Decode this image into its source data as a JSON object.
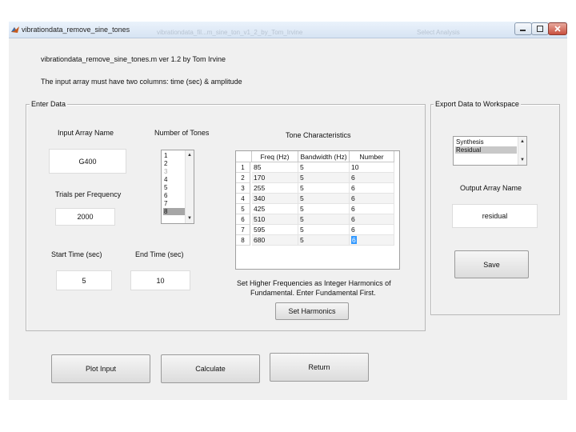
{
  "window": {
    "title": "vibrationdata_remove_sine_tones",
    "ghost_text_1": "vibrationdata_fil...m_sine_ton_v1_2_by_Tom_Irvine",
    "ghost_text_2": "Select Analysis"
  },
  "header": {
    "line1": "vibrationdata_remove_sine_tones.m ver 1.2 by Tom Irvine",
    "line2": "The input array must have two columns: time (sec) & amplitude"
  },
  "enter_data": {
    "title": "Enter Data",
    "input_array_label": "Input Array Name",
    "input_array_value": "G400",
    "trials_label": "Trials per Frequency",
    "trials_value": "2000",
    "start_time_label": "Start Time (sec)",
    "start_time_value": "5",
    "end_time_label": "End Time (sec)",
    "end_time_value": "10",
    "num_tones_label": "Number of Tones",
    "num_tones_options": [
      "1",
      "2",
      "3",
      "4",
      "5",
      "6",
      "7",
      "8"
    ],
    "num_tones_selected": "8",
    "tone_title": "Tone Characteristics",
    "tone_columns": [
      "Freq (Hz)",
      "Bandwidth (Hz)",
      "Number"
    ],
    "tone_rows": [
      {
        "n": "1",
        "freq": "85",
        "bw": "5",
        "num": "10"
      },
      {
        "n": "2",
        "freq": "170",
        "bw": "5",
        "num": "6"
      },
      {
        "n": "3",
        "freq": "255",
        "bw": "5",
        "num": "6"
      },
      {
        "n": "4",
        "freq": "340",
        "bw": "5",
        "num": "6"
      },
      {
        "n": "5",
        "freq": "425",
        "bw": "5",
        "num": "6"
      },
      {
        "n": "6",
        "freq": "510",
        "bw": "5",
        "num": "6"
      },
      {
        "n": "7",
        "freq": "595",
        "bw": "5",
        "num": "6"
      },
      {
        "n": "8",
        "freq": "680",
        "bw": "5",
        "num": "6"
      }
    ],
    "harmonics_note_1": "Set Higher Frequencies as Integer Harmonics of",
    "harmonics_note_2": "Fundamental. Enter Fundamental First.",
    "set_harmonics_label": "Set Harmonics"
  },
  "export": {
    "title": "Export Data to Workspace",
    "options": [
      "Synthesis",
      "Residual"
    ],
    "selected": "Residual",
    "output_label": "Output Array Name",
    "output_value": "residual",
    "save_label": "Save"
  },
  "buttons": {
    "plot_input": "Plot Input",
    "calculate": "Calculate",
    "return": "Return"
  }
}
